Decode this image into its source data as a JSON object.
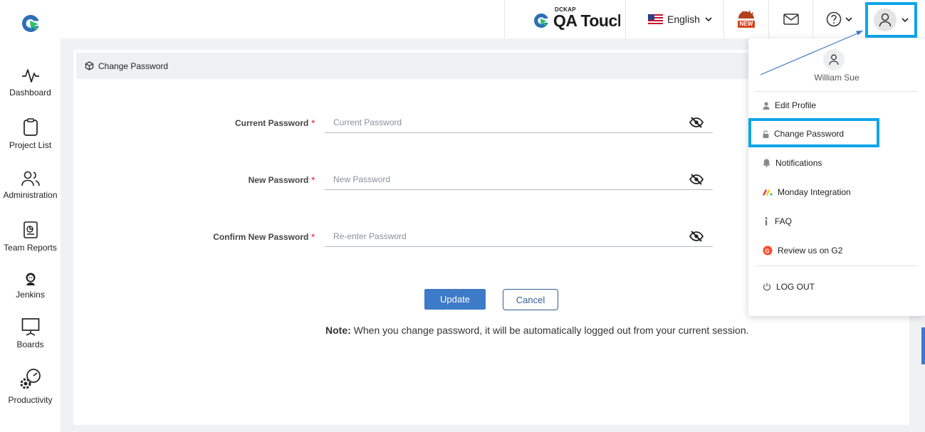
{
  "header": {
    "brand_tag": "DCKAP",
    "brand_name": "QA Touch",
    "language": "English",
    "new_badge": "NEW"
  },
  "sidebar": {
    "items": [
      {
        "label": "Dashboard"
      },
      {
        "label": "Project List"
      },
      {
        "label": "Administration"
      },
      {
        "label": "Team Reports"
      },
      {
        "label": "Jenkins"
      },
      {
        "label": "Boards"
      },
      {
        "label": "Productivity"
      }
    ]
  },
  "page": {
    "title": "Change Password",
    "fields": [
      {
        "label": "Current Password",
        "required": "*",
        "placeholder": "Current Password",
        "value": ""
      },
      {
        "label": "New Password",
        "required": "*",
        "placeholder": "New Password",
        "value": ""
      },
      {
        "label": "Confirm New Password",
        "required": "*",
        "placeholder": "Re-enter Password",
        "value": ""
      }
    ],
    "update_label": "Update",
    "cancel_label": "Cancel",
    "note_label": "Note:",
    "note_text": " When you change password, it will be automatically logged out from your current session."
  },
  "user_menu": {
    "user_name": "William Sue",
    "items": [
      {
        "label": "Edit Profile",
        "icon": "person-icon"
      },
      {
        "label": "Change Password",
        "icon": "lock-icon"
      },
      {
        "label": "Notifications",
        "icon": "bell-icon"
      },
      {
        "label": "Monday Integration",
        "icon": "monday-icon"
      },
      {
        "label": "FAQ",
        "icon": "info-icon"
      },
      {
        "label": "Review us on G2",
        "icon": "g2-icon"
      },
      {
        "label": "LOG OUT",
        "icon": "power-icon"
      }
    ]
  },
  "colors": {
    "accent": "#3d7ac8",
    "highlight": "#0ea5e9",
    "required": "#e5484d"
  }
}
